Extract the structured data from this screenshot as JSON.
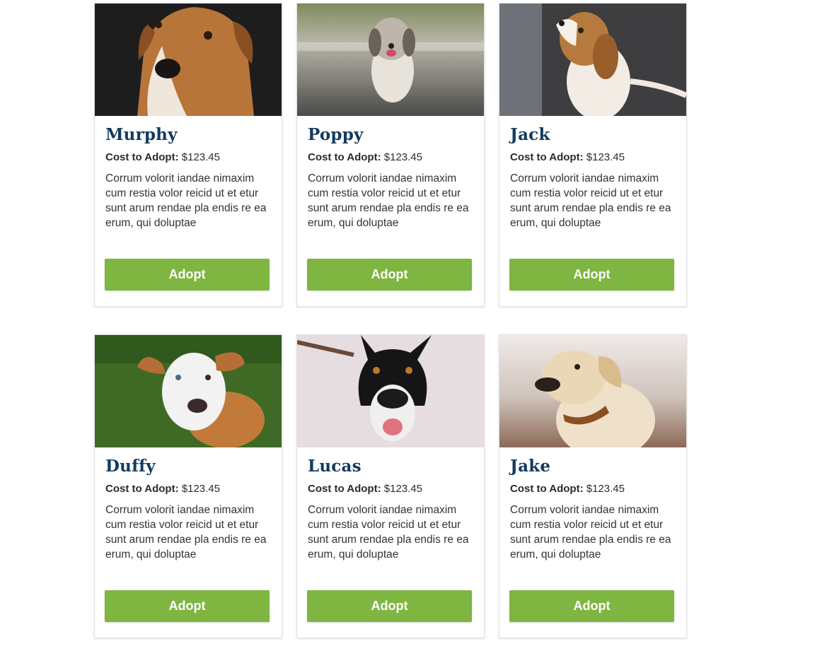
{
  "pets": [
    {
      "name": "Murphy",
      "cost_label": "Cost to Adopt:",
      "cost_value": "$123.45",
      "description": "Corrum volorit iandae nimaxim cum restia volor reicid ut et etur sunt arum rendae pla endis re ea erum, qui doluptae",
      "button": "Adopt"
    },
    {
      "name": "Poppy",
      "cost_label": "Cost to Adopt:",
      "cost_value": "$123.45",
      "description": "Corrum volorit iandae nimaxim cum restia volor reicid ut et etur sunt arum rendae pla endis re ea erum, qui doluptae",
      "button": "Adopt"
    },
    {
      "name": "Jack",
      "cost_label": "Cost to Adopt:",
      "cost_value": "$123.45",
      "description": "Corrum volorit iandae nimaxim cum restia volor reicid ut et etur sunt arum rendae pla endis re ea erum, qui doluptae",
      "button": "Adopt"
    },
    {
      "name": "Duffy",
      "cost_label": "Cost to Adopt:",
      "cost_value": "$123.45",
      "description": "Corrum volorit iandae nimaxim cum restia volor reicid ut et etur sunt arum rendae pla endis re ea erum, qui doluptae",
      "button": "Adopt"
    },
    {
      "name": "Lucas",
      "cost_label": "Cost to Adopt:",
      "cost_value": "$123.45",
      "description": "Corrum volorit iandae nimaxim cum restia volor reicid ut et etur sunt arum rendae pla endis re ea erum, qui doluptae",
      "button": "Adopt"
    },
    {
      "name": "Jake",
      "cost_label": "Cost to Adopt:",
      "cost_value": "$123.45",
      "description": "Corrum volorit iandae nimaxim cum restia volor reicid ut et etur sunt arum rendae pla endis re ea erum, qui doluptae",
      "button": "Adopt"
    }
  ],
  "colors": {
    "name_text": "#123b5e",
    "button_bg": "#7fb541",
    "button_text": "#ffffff"
  }
}
